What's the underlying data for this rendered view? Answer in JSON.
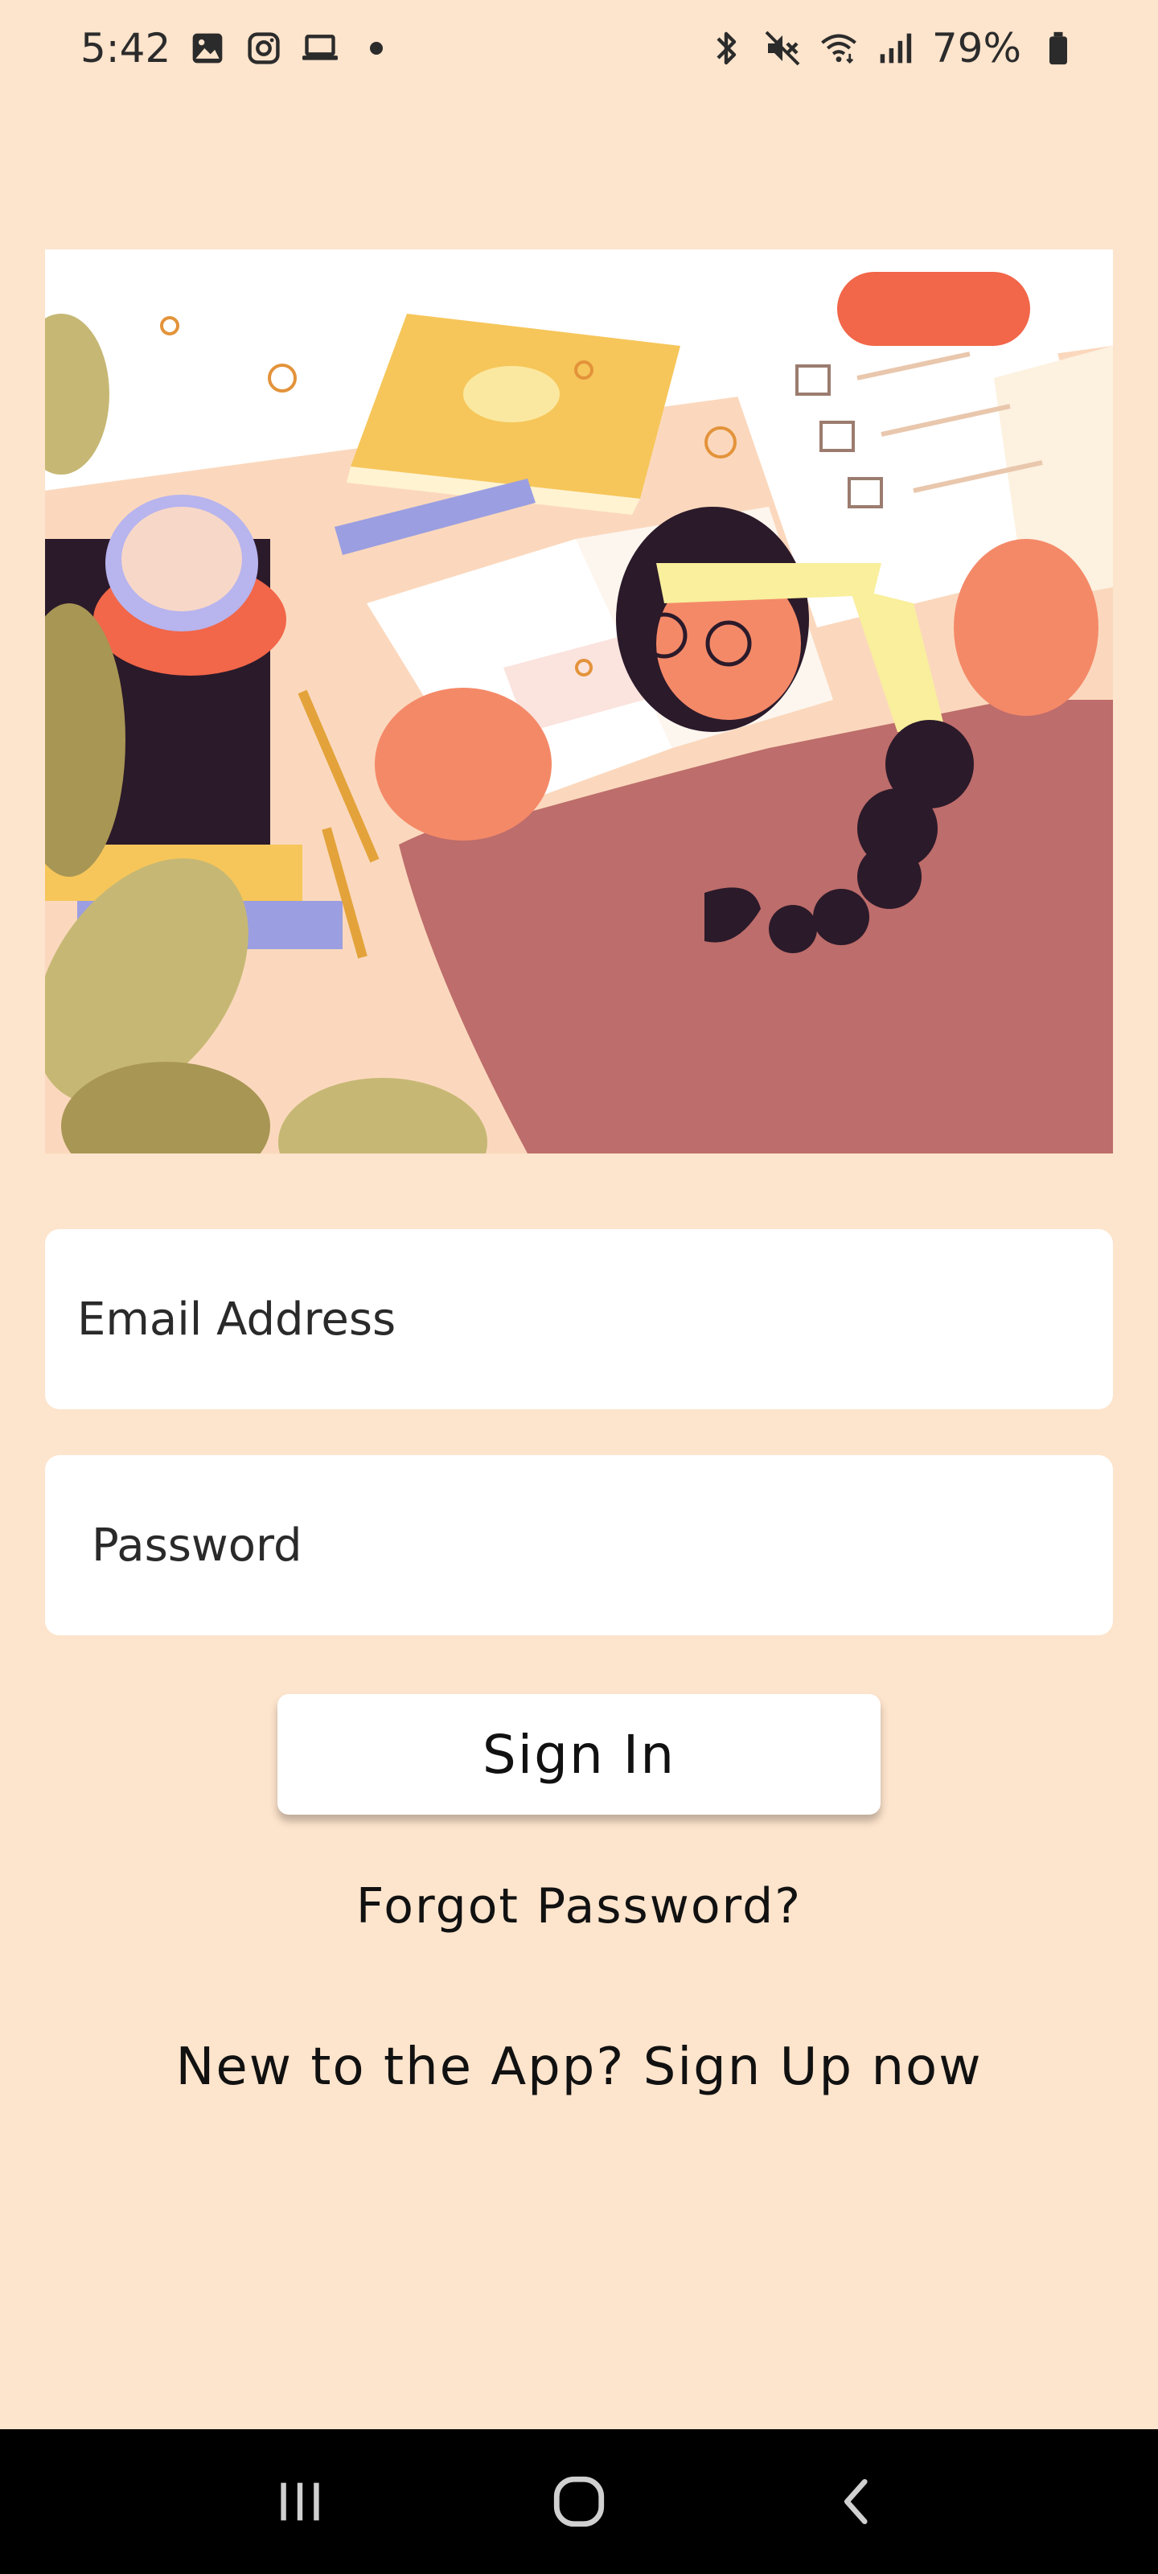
{
  "status_bar": {
    "time": "5:42",
    "battery": "79%",
    "left_icons": [
      "gallery-icon",
      "instagram-icon",
      "laptop-icon",
      "dot-icon"
    ],
    "right_icons": [
      "bluetooth-icon",
      "mute-icon",
      "wifi-icon",
      "signal-icon",
      "battery-icon"
    ]
  },
  "illustration": {
    "description_icon": "student-studying-illustration"
  },
  "login_form": {
    "email_placeholder": "Email Address",
    "password_placeholder": "Password",
    "sign_in_label": "Sign In",
    "forgot_password_label": "Forgot Password?",
    "sign_up_label": "New to the App? Sign Up now"
  },
  "nav_bar": {
    "buttons": [
      "recents-icon",
      "home-icon",
      "back-icon"
    ]
  },
  "colors": {
    "background": "#fde4cc",
    "field_background": "#ffffff",
    "nav_background": "#000000"
  }
}
